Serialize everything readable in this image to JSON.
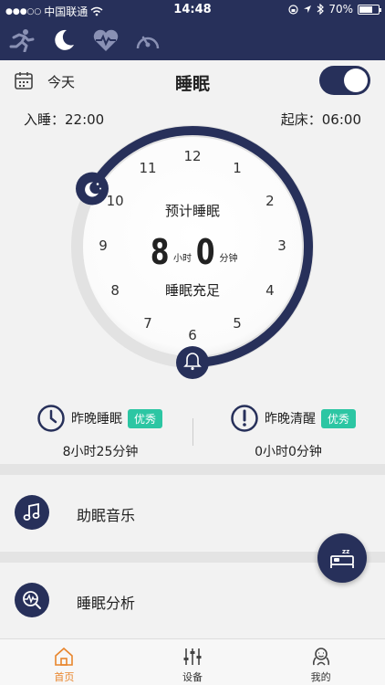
{
  "status": {
    "carrier": "中国联通",
    "time": "14:48",
    "battery": "70%",
    "battery_level": 0.7
  },
  "top_tabs": [
    {
      "icon": "running-icon"
    },
    {
      "icon": "moon-icon"
    },
    {
      "icon": "heart-pulse-icon"
    },
    {
      "icon": "gauge-icon"
    }
  ],
  "header": {
    "today": "今天",
    "title": "睡眠",
    "toggle_on": true
  },
  "times": {
    "sleep": "入睡：22:00",
    "wake": "起床：06:00"
  },
  "dial": {
    "plan_label": "预计睡眠",
    "hours": "8",
    "hours_unit": "小时",
    "minutes": "0",
    "minutes_unit": "分钟",
    "status": "睡眠充足",
    "numbers": [
      "12",
      "1",
      "2",
      "3",
      "4",
      "5",
      "6",
      "7",
      "8",
      "9",
      "10",
      "11"
    ],
    "arc_color": "#27305a"
  },
  "stats": {
    "last_sleep": {
      "label": "昨晚睡眠",
      "badge": "优秀",
      "value": "8小时25分钟"
    },
    "last_awake": {
      "label": "昨晚清醒",
      "badge": "优秀",
      "value": "0小时0分钟"
    }
  },
  "rows": [
    {
      "label": "助眠音乐",
      "icon": "music-note-icon"
    },
    {
      "label": "睡眠分析",
      "icon": "sleep-analysis-icon"
    }
  ],
  "bottom_nav": [
    {
      "label": "首页",
      "icon": "home-icon",
      "active": true
    },
    {
      "label": "设备",
      "icon": "sliders-icon",
      "active": false
    },
    {
      "label": "我的",
      "icon": "user-icon",
      "active": false
    }
  ],
  "colors": {
    "brand": "#27305a",
    "badge": "#2cc6a3",
    "active": "#e8852c"
  }
}
